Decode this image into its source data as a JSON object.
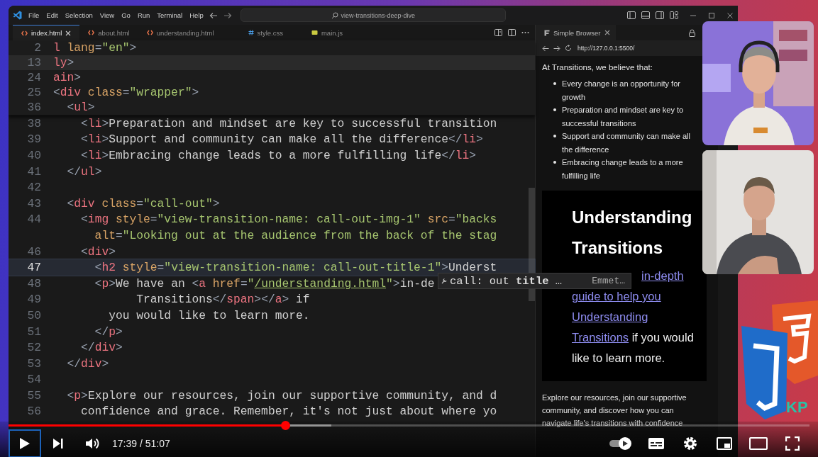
{
  "window": {
    "menu": [
      "File",
      "Edit",
      "Selection",
      "View",
      "Go",
      "Run",
      "Terminal",
      "Help"
    ],
    "search": "view-transitions-deep-dive"
  },
  "editor": {
    "tabs": [
      {
        "label": "index.html",
        "kind": "html",
        "selected": true
      },
      {
        "label": "about.html",
        "kind": "html",
        "selected": false
      },
      {
        "label": "understanding.html",
        "kind": "html",
        "selected": false
      },
      {
        "label": "style.css",
        "kind": "css",
        "selected": false
      },
      {
        "label": "main.js",
        "kind": "js",
        "selected": false
      }
    ],
    "sticky_lines": [
      {
        "num": "2",
        "highlighted": false,
        "tokens": [
          {
            "kind": "tag",
            "text": "l"
          },
          {
            "kind": "attr",
            "text": " lang"
          },
          {
            "kind": "punct",
            "text": "="
          },
          {
            "kind": "str",
            "text": "\"en\""
          },
          {
            "kind": "punct",
            "text": ">"
          }
        ]
      },
      {
        "num": "13",
        "highlighted": true,
        "tokens": [
          {
            "kind": "tag",
            "text": "ly"
          },
          {
            "kind": "punct",
            "text": ">"
          }
        ]
      },
      {
        "num": "24",
        "highlighted": false,
        "tokens": [
          {
            "kind": "tag",
            "text": "ain"
          },
          {
            "kind": "punct",
            "text": ">"
          }
        ]
      },
      {
        "num": "25",
        "highlighted": false,
        "tokens": [
          {
            "kind": "punct",
            "text": "<"
          },
          {
            "kind": "tag",
            "text": "div"
          },
          {
            "kind": "attr",
            "text": " class"
          },
          {
            "kind": "punct",
            "text": "="
          },
          {
            "kind": "str",
            "text": "\"wrapper\""
          },
          {
            "kind": "punct",
            "text": ">"
          }
        ]
      },
      {
        "num": "36",
        "highlighted": false,
        "tokens": [
          {
            "kind": "punct",
            "text": "  <"
          },
          {
            "kind": "tag",
            "text": "ul"
          },
          {
            "kind": "punct",
            "text": ">"
          }
        ]
      }
    ],
    "lines": [
      {
        "num": "38",
        "highlighted": false,
        "tokens": [
          {
            "kind": "punct",
            "text": "    <"
          },
          {
            "kind": "tag",
            "text": "li"
          },
          {
            "kind": "punct",
            "text": ">"
          },
          {
            "kind": "text",
            "text": "Preparation and mindset are key to successful transition"
          }
        ]
      },
      {
        "num": "39",
        "highlighted": false,
        "tokens": [
          {
            "kind": "punct",
            "text": "    <"
          },
          {
            "kind": "tag",
            "text": "li"
          },
          {
            "kind": "punct",
            "text": ">"
          },
          {
            "kind": "text",
            "text": "Support and community can make all the difference"
          },
          {
            "kind": "punct",
            "text": "</"
          },
          {
            "kind": "tag",
            "text": "li"
          },
          {
            "kind": "punct",
            "text": ">"
          }
        ]
      },
      {
        "num": "40",
        "highlighted": false,
        "tokens": [
          {
            "kind": "punct",
            "text": "    <"
          },
          {
            "kind": "tag",
            "text": "li"
          },
          {
            "kind": "punct",
            "text": ">"
          },
          {
            "kind": "text",
            "text": "Embracing change leads to a more fulfilling life"
          },
          {
            "kind": "punct",
            "text": "</"
          },
          {
            "kind": "tag",
            "text": "li"
          },
          {
            "kind": "punct",
            "text": ">"
          }
        ]
      },
      {
        "num": "41",
        "highlighted": false,
        "tokens": [
          {
            "kind": "punct",
            "text": "  </"
          },
          {
            "kind": "tag",
            "text": "ul"
          },
          {
            "kind": "punct",
            "text": ">"
          }
        ]
      },
      {
        "num": "42",
        "highlighted": false
      },
      {
        "num": "43",
        "highlighted": false,
        "tokens": [
          {
            "kind": "punct",
            "text": "  <"
          },
          {
            "kind": "tag",
            "text": "div"
          },
          {
            "kind": "attr",
            "text": " class"
          },
          {
            "kind": "punct",
            "text": "="
          },
          {
            "kind": "str",
            "text": "\"call-out\""
          },
          {
            "kind": "punct",
            "text": ">"
          }
        ]
      },
      {
        "num": "44",
        "highlighted": false,
        "tokens": [
          {
            "kind": "punct",
            "text": "    <"
          },
          {
            "kind": "tag",
            "text": "img"
          },
          {
            "kind": "attr",
            "text": " style"
          },
          {
            "kind": "punct",
            "text": "="
          },
          {
            "kind": "str",
            "text": "\"view-transition-name: call-out-img-1\""
          },
          {
            "kind": "attr",
            "text": " src"
          },
          {
            "kind": "punct",
            "text": "="
          },
          {
            "kind": "str",
            "text": "\"backs"
          }
        ]
      },
      {
        "highlighted": false,
        "tokens": [
          {
            "kind": "attr",
            "text": "      alt"
          },
          {
            "kind": "punct",
            "text": "="
          },
          {
            "kind": "str",
            "text": "\"Looking out at the audience from the back of the stag"
          }
        ]
      },
      {
        "num": "46",
        "highlighted": false,
        "tokens": [
          {
            "kind": "punct",
            "text": "    <"
          },
          {
            "kind": "tag",
            "text": "div"
          },
          {
            "kind": "punct",
            "text": ">"
          }
        ]
      },
      {
        "num": "47",
        "highlighted": true,
        "tokens": [
          {
            "kind": "punct",
            "text": "      <"
          },
          {
            "kind": "tag",
            "text": "h2"
          },
          {
            "kind": "attr",
            "text": " style"
          },
          {
            "kind": "punct",
            "text": "="
          },
          {
            "kind": "str",
            "text": "\"view-transition-name: call-out-title-1\""
          },
          {
            "kind": "punct",
            "text": ">"
          },
          {
            "kind": "text",
            "text": "Underst"
          }
        ]
      },
      {
        "num": "48",
        "highlighted": false,
        "tokens": [
          {
            "kind": "punct",
            "text": "      <"
          },
          {
            "kind": "tag",
            "text": "p"
          },
          {
            "kind": "punct",
            "text": ">"
          },
          {
            "kind": "text",
            "text": "We have an "
          },
          {
            "kind": "punct",
            "text": "<"
          },
          {
            "kind": "tag",
            "text": "a"
          },
          {
            "kind": "attr",
            "text": " href"
          },
          {
            "kind": "punct",
            "text": "="
          },
          {
            "kind": "str",
            "text": "\""
          },
          {
            "kind": "link",
            "text": "/understanding.html"
          },
          {
            "kind": "str",
            "text": "\""
          },
          {
            "kind": "punct",
            "text": ">"
          },
          {
            "kind": "text",
            "text": "in-de"
          }
        ]
      },
      {
        "num": "49",
        "highlighted": false,
        "tokens": [
          {
            "kind": "text",
            "text": "            Transitions"
          },
          {
            "kind": "punct",
            "text": "</"
          },
          {
            "kind": "tag",
            "text": "span"
          },
          {
            "kind": "punct",
            "text": "></"
          },
          {
            "kind": "tag",
            "text": "a"
          },
          {
            "kind": "punct",
            "text": ">"
          },
          {
            "kind": "text",
            "text": " if"
          }
        ]
      },
      {
        "num": "50",
        "highlighted": false,
        "tokens": [
          {
            "kind": "text",
            "text": "        you would like to learn more."
          }
        ]
      },
      {
        "num": "51",
        "highlighted": false,
        "tokens": [
          {
            "kind": "punct",
            "text": "      </"
          },
          {
            "kind": "tag",
            "text": "p"
          },
          {
            "kind": "punct",
            "text": ">"
          }
        ]
      },
      {
        "num": "52",
        "highlighted": false,
        "tokens": [
          {
            "kind": "punct",
            "text": "    </"
          },
          {
            "kind": "tag",
            "text": "div"
          },
          {
            "kind": "punct",
            "text": ">"
          }
        ]
      },
      {
        "num": "53",
        "highlighted": false,
        "tokens": [
          {
            "kind": "punct",
            "text": "  </"
          },
          {
            "kind": "tag",
            "text": "div"
          },
          {
            "kind": "punct",
            "text": ">"
          }
        ]
      },
      {
        "num": "54",
        "highlighted": false
      },
      {
        "num": "55",
        "highlighted": false,
        "tokens": [
          {
            "kind": "punct",
            "text": "  <"
          },
          {
            "kind": "tag",
            "text": "p"
          },
          {
            "kind": "punct",
            "text": ">"
          },
          {
            "kind": "text",
            "text": "Explore our resources, join our supportive community, and d"
          }
        ]
      },
      {
        "num": "56",
        "highlighted": false,
        "tokens": [
          {
            "kind": "text",
            "text": "    confidence and grace. Remember, it's not just about where yo"
          }
        ]
      }
    ],
    "autocomplete": {
      "label": "call: out **title** …",
      "source": "Emmet…"
    }
  },
  "browser": {
    "tab": "Simple Browser",
    "url": "http://127.0.0.1:5500/",
    "intro": "At Transitions, we believe that:",
    "bullets": [
      "Every change is an opportunity for growth",
      "Preparation and mindset are key to successful transitions",
      "Support and community can make all the difference",
      "Embracing change leads to a more fulfilling life"
    ],
    "card": {
      "heading": "Understanding Transitions",
      "lines": [
        [
          {
            "kind": "link",
            "text": "in-depth"
          }
        ],
        [
          {
            "kind": "link",
            "text": "guide to help you"
          }
        ],
        [
          {
            "kind": "link",
            "text": "Understanding"
          }
        ],
        [
          {
            "kind": "link",
            "text": "Transitions"
          },
          {
            "kind": "text",
            "text": " if you would"
          }
        ],
        [
          {
            "kind": "text",
            "text": "like to learn more."
          }
        ]
      ]
    },
    "outro": "Explore our resources, join our supportive community, and discover how you can navigate life's transitions with confidence"
  },
  "logo_text": "KP",
  "player": {
    "progress": {
      "level": 0.345
    },
    "buffer": {
      "level": 0.403
    },
    "time": "17:39 / 51:07"
  }
}
